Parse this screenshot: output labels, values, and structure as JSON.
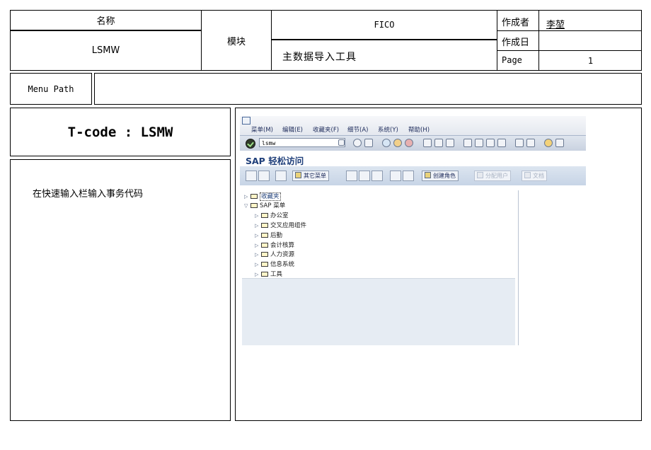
{
  "header": {
    "name_label": "名称",
    "name_value": "LSMW",
    "module_label": "模块",
    "module_value": "FICO",
    "subtitle": "主数据导入工具",
    "author_label": "作成者",
    "author_value": "李堃",
    "date_label": "作成日",
    "date_value": "",
    "page_label": "Page",
    "page_value": "1"
  },
  "menu_path": {
    "label": "Menu Path",
    "value": ""
  },
  "left": {
    "tcode": "T-code : LSMW",
    "instruction": "在快速输入栏输入事务代码"
  },
  "sap": {
    "menus": [
      "菜单(M)",
      "编辑(E)",
      "收藏夹(F)",
      "细节(A)",
      "系统(Y)",
      "帮助(H)"
    ],
    "command_value": "lsmw",
    "screen_title": "SAP 轻松访问",
    "app_buttons": {
      "other_menu": "其它菜单",
      "create_role": "创建角色",
      "assign_users": "分配用户",
      "documentation": "文档"
    },
    "tree": {
      "favorites": "收藏夹",
      "sap_menu": "SAP 菜单",
      "items": [
        "办公室",
        "交叉应用组件",
        "后勤",
        "会计核算",
        "人力资源",
        "信息系统",
        "工具"
      ]
    }
  }
}
